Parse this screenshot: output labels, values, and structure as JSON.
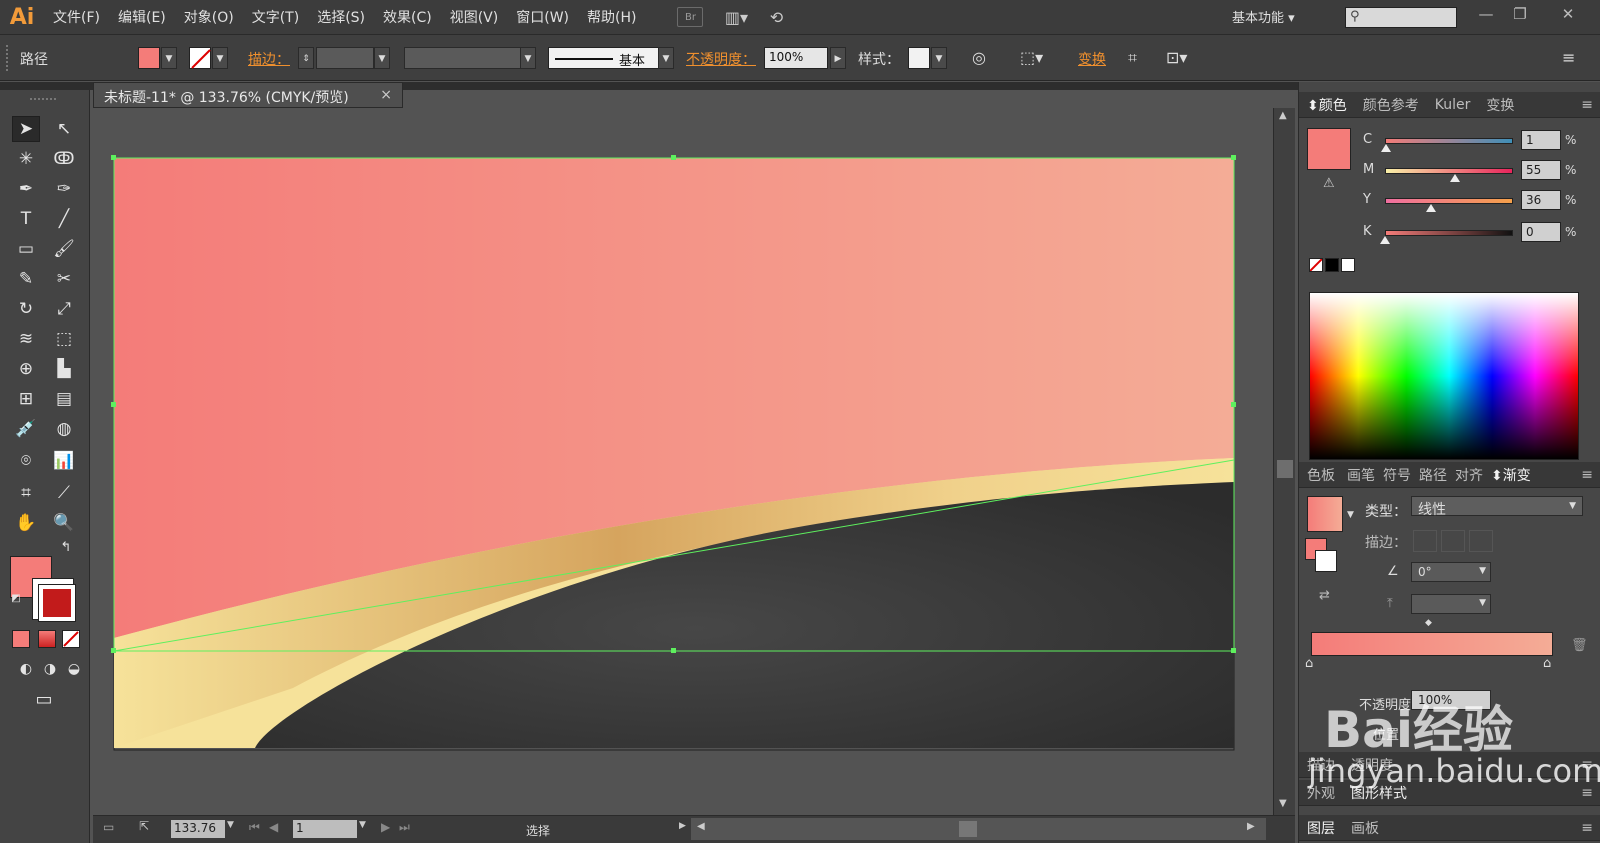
{
  "menubar": {
    "logo": "Ai",
    "items": [
      "文件(F)",
      "编辑(E)",
      "对象(O)",
      "文字(T)",
      "选择(S)",
      "效果(C)",
      "视图(V)",
      "窗口(W)",
      "帮助(H)"
    ],
    "bridge": "Br",
    "workspace": "基本功能",
    "window_controls": [
      "—",
      "❐",
      "✕"
    ]
  },
  "control": {
    "object_type": "路径",
    "stroke_label": "描边：",
    "brush_label": "基本",
    "opacity_label": "不透明度：",
    "opacity_value": "100%",
    "style_label": "样式：",
    "transform_label": "变换",
    "fill_color": "#f47c79"
  },
  "document": {
    "tab_title": "未标题-11* @ 133.76% (CMYK/预览)",
    "close": "×"
  },
  "artwork": {
    "gradient_start": "#f47c79",
    "gradient_end": "#f4ac96",
    "gold_light": "#f6e29a",
    "gold_dark": "#d4a15b",
    "dark_fill": "#333333",
    "selection_color": "#5ef05e"
  },
  "statusbar": {
    "zoom": "133.76",
    "page": "1",
    "tool": "选择"
  },
  "color_panel": {
    "tabs": [
      "颜色",
      "颜色参考",
      "Kuler",
      "变换"
    ],
    "swatch": "#f47c79",
    "channels": [
      {
        "name": "C",
        "value": "1",
        "fraction": 0.01
      },
      {
        "name": "M",
        "value": "55",
        "fraction": 0.55
      },
      {
        "name": "Y",
        "value": "36",
        "fraction": 0.36
      },
      {
        "name": "K",
        "value": "0",
        "fraction": 0.0
      }
    ],
    "percent": "%"
  },
  "gradient_panel": {
    "tabs": [
      "色板",
      "画笔",
      "符号",
      "路径",
      "对齐",
      "渐变"
    ],
    "type_label": "类型：",
    "type_value": "线性",
    "stroke_label": "描边：",
    "angle_value": "0°",
    "opacity_label": "不透明度",
    "opacity_value": "100%",
    "position_label": "位置"
  },
  "lower_panels": {
    "tabs_a": [
      "描边",
      "透明度"
    ],
    "tabs_b": [
      "外观",
      "图形样式"
    ],
    "tabs_c": [
      "图层",
      "画板"
    ]
  },
  "watermark": {
    "line1": "Bai经验",
    "line2": "jingyan.baidu.com"
  },
  "icons": [
    "selection-tool-icon",
    "direct-selection-icon",
    "magic-wand-icon",
    "lasso-icon",
    "pen-icon",
    "type-icon",
    "line-icon",
    "rectangle-icon",
    "brush-icon",
    "pencil-icon",
    "scissors-icon",
    "rotate-icon",
    "scale-icon",
    "warp-icon",
    "free-transform-icon",
    "shape-builder-icon",
    "graph-icon",
    "mesh-icon",
    "gradient-icon",
    "eyedropper-icon",
    "blend-icon",
    "symbol-sprayer-icon",
    "column-graph-icon",
    "artboard-icon",
    "slice-icon",
    "hand-icon",
    "zoom-icon",
    "search-icon"
  ]
}
